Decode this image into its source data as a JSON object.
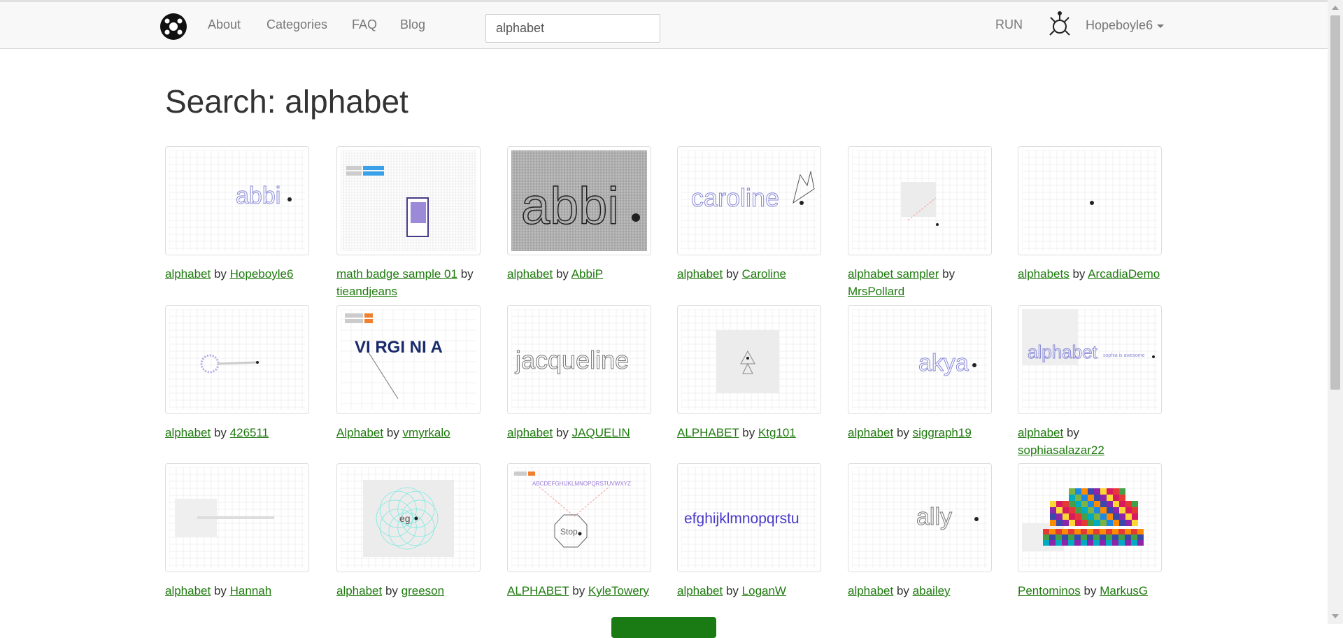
{
  "nav": {
    "links": [
      "About",
      "Categories",
      "FAQ",
      "Blog"
    ],
    "search_value": "alphabet",
    "run_label": "RUN",
    "username": "Hopeboyle6"
  },
  "page_title": "Search: alphabet",
  "results": [
    {
      "title": "alphabet",
      "by": "by",
      "author": "Hopeboyle6",
      "thumb": "abbi-small"
    },
    {
      "title": "math badge sample 01",
      "by": "by",
      "author": "tieandjeans",
      "thumb": "badge"
    },
    {
      "title": "alphabet",
      "by": "by",
      "author": "AbbiP",
      "thumb": "abbi-dark"
    },
    {
      "title": "alphabet",
      "by": "by",
      "author": "Caroline",
      "thumb": "caroline"
    },
    {
      "title": "alphabet sampler",
      "by": "by",
      "author": "MrsPollard",
      "thumb": "sampler"
    },
    {
      "title": "alphabets",
      "by": "by",
      "author": "ArcadiaDemo",
      "thumb": "dot"
    },
    {
      "title": "alphabet",
      "by": "by",
      "author": "426511",
      "thumb": "spiro"
    },
    {
      "title": "Alphabet",
      "by": "by",
      "author": "vmyrkalo",
      "thumb": "virginia"
    },
    {
      "title": "alphabet",
      "by": "by",
      "author": "JAQUELIN",
      "thumb": "jacqueline"
    },
    {
      "title": "ALPHABET",
      "by": "by",
      "author": "Ktg101",
      "thumb": "triangle"
    },
    {
      "title": "alphabet",
      "by": "by",
      "author": "siggraph19",
      "thumb": "akya"
    },
    {
      "title": "alphabet",
      "by": "by",
      "author": "sophiasalazar22",
      "thumb": "alphabet-script"
    },
    {
      "title": "alphabet",
      "by": "by",
      "author": "Hannah",
      "thumb": "faded"
    },
    {
      "title": "alphabet",
      "by": "by",
      "author": "greeson",
      "thumb": "circles"
    },
    {
      "title": "ALPHABET",
      "by": "by",
      "author": "KyleTowery",
      "thumb": "stop"
    },
    {
      "title": "alphabet",
      "by": "by",
      "author": "LoganW",
      "thumb": "efghij"
    },
    {
      "title": "alphabet",
      "by": "by",
      "author": "abailey",
      "thumb": "ally"
    },
    {
      "title": "Pentominos",
      "by": "by",
      "author": "MarkusG",
      "thumb": "pentominos"
    }
  ],
  "thumb_text": {
    "virginia": "VI RGI NI A",
    "jacqueline": "jacqueline",
    "efghij": "efghijklmnopqrstu",
    "stop_alphabet": "ABCDEFGHIJKLMNOPQRSTUVWXYZ",
    "stop": "Stop",
    "akya": "akya",
    "ally": "ally",
    "caroline": "caroline",
    "abbi": "abbi",
    "alphabet_script": "alphabet",
    "sophia": "sophia is awesome",
    "greeson": "eg"
  }
}
